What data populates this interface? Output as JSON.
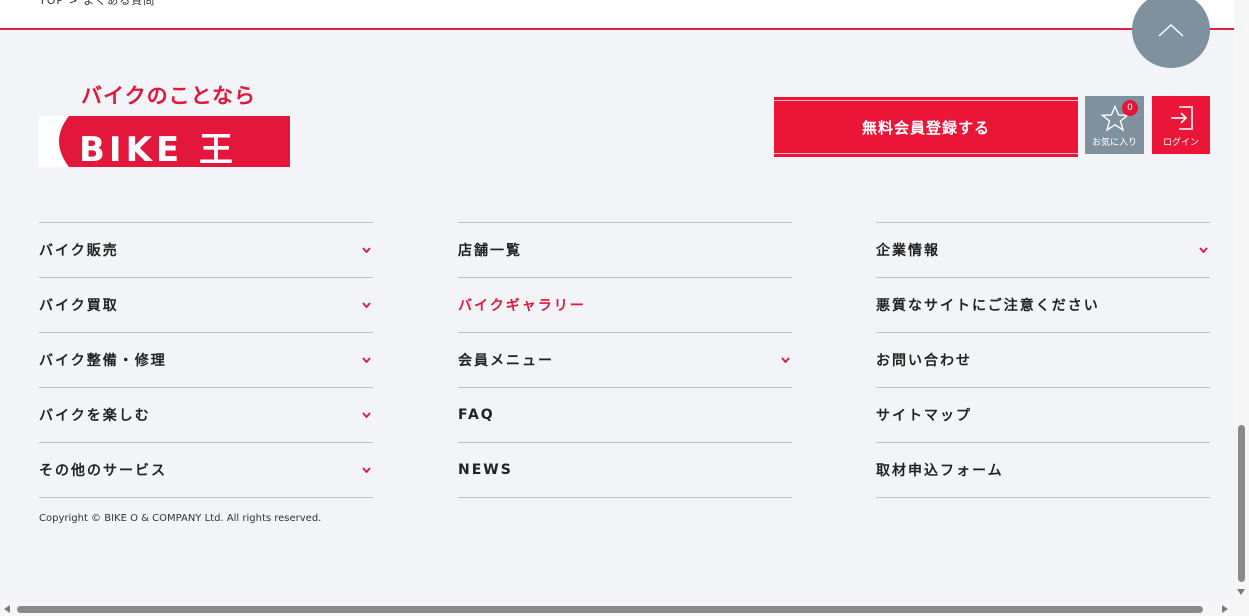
{
  "breadcrumb": "TOP > よくある質問",
  "logo": {
    "tagline": "バイクのことなら",
    "brand": "BIKE 王"
  },
  "header_actions": {
    "register_label": "無料会員登録する",
    "favorites_label": "お気に入り",
    "favorites_count": "0",
    "login_label": "ログイン"
  },
  "footer_nav": {
    "col1": [
      {
        "label": "バイク販売",
        "has_dropdown": true
      },
      {
        "label": "バイク買取",
        "has_dropdown": true
      },
      {
        "label": "バイク整備・修理",
        "has_dropdown": true
      },
      {
        "label": "バイクを楽しむ",
        "has_dropdown": true
      },
      {
        "label": "その他のサービス",
        "has_dropdown": true
      }
    ],
    "col2": [
      {
        "label": "店舗一覧",
        "has_dropdown": false
      },
      {
        "label": "バイクギャラリー",
        "has_dropdown": false,
        "highlight": true
      },
      {
        "label": "会員メニュー",
        "has_dropdown": true
      },
      {
        "label": "FAQ",
        "has_dropdown": false
      },
      {
        "label": "NEWS",
        "has_dropdown": false
      }
    ],
    "col3": [
      {
        "label": "企業情報",
        "has_dropdown": true
      },
      {
        "label": "悪質なサイトにご注意ください",
        "has_dropdown": false
      },
      {
        "label": "お問い合わせ",
        "has_dropdown": false
      },
      {
        "label": "サイトマップ",
        "has_dropdown": false
      },
      {
        "label": "取材申込フォーム",
        "has_dropdown": false
      }
    ]
  },
  "copyright": "Copyright © BIKE O & COMPANY Ltd. All rights reserved.",
  "colors": {
    "accent": "#e3163b",
    "gray_button": "#7f919f",
    "background": "#f2f4f7"
  },
  "icons": {
    "pagetop": "chevron-up-icon",
    "favorites": "star-icon",
    "login": "login-arrow-icon",
    "dropdown": "chevron-down-icon"
  }
}
